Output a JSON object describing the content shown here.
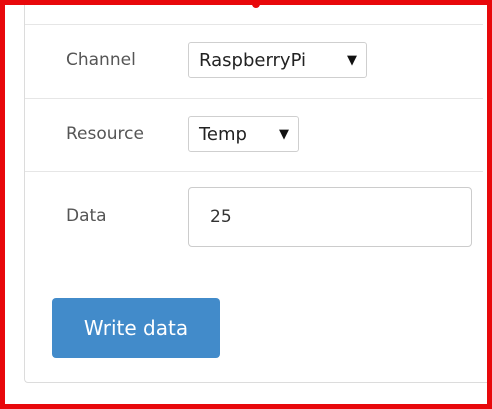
{
  "form": {
    "channel": {
      "label": "Channel",
      "selected": "RaspberryPi"
    },
    "resource": {
      "label": "Resource",
      "selected": "Temp"
    },
    "data": {
      "label": "Data",
      "value": "25"
    },
    "submit_label": "Write data"
  },
  "icons": {
    "caret": "▼"
  },
  "colors": {
    "highlight_border": "#e8080b",
    "button": "#428bca"
  }
}
